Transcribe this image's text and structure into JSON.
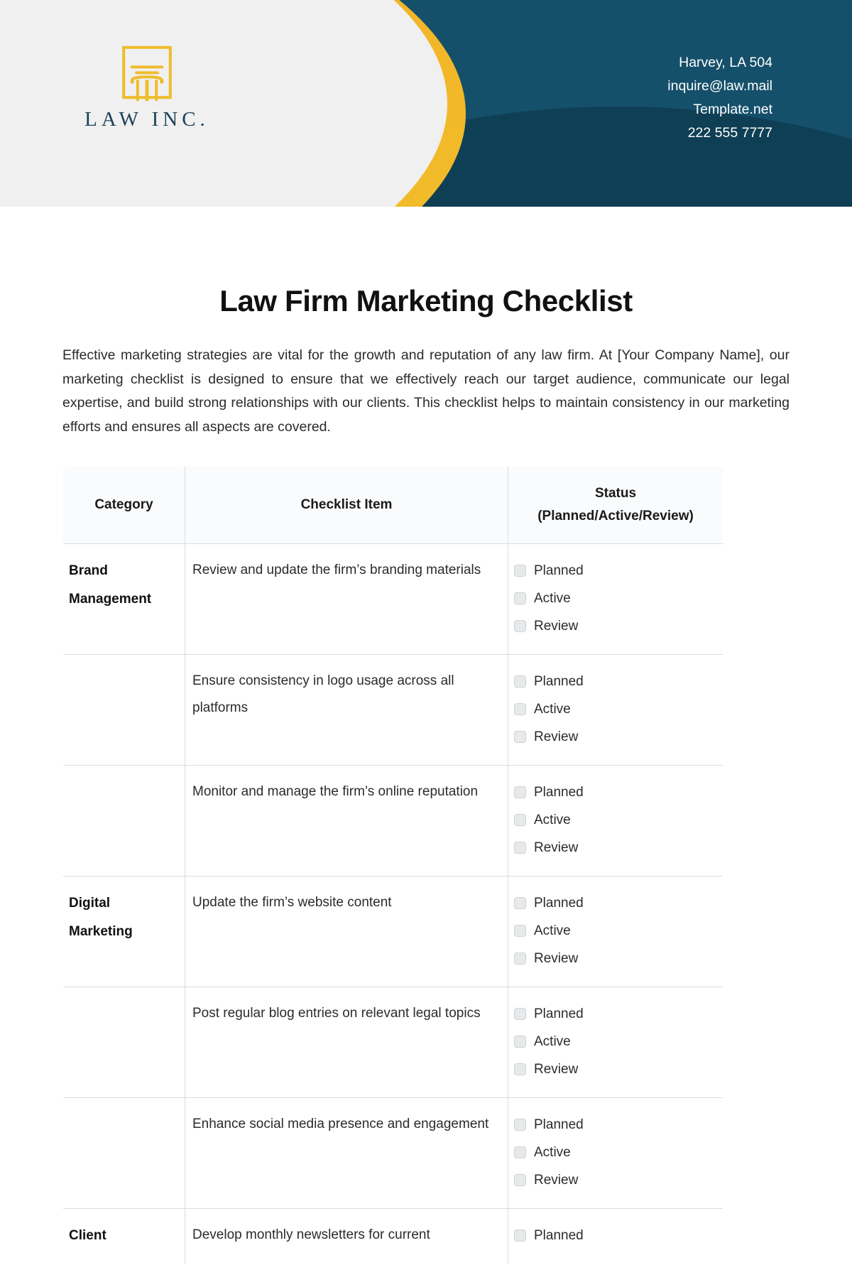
{
  "brand": {
    "logo_icon": "law-pillar-icon",
    "name": "LAW INC."
  },
  "header": {
    "contact_lines": [
      "Harvey, LA 504",
      "inquire@law.mail",
      "Template.net",
      "222 555 7777"
    ],
    "colors": {
      "dark_teal": "#11445c",
      "orange": "#f0a41f",
      "yellow": "#efc12b",
      "light_gray": "#f0f0f0",
      "logo_gold": "#eebc2c",
      "logo_navy": "#1d4258"
    }
  },
  "document": {
    "title": "Law Firm Marketing Checklist",
    "intro": "Effective marketing strategies are vital for the growth and reputation of any law firm. At [Your Company Name], our marketing checklist is designed to ensure that we effectively reach our target audience, communicate our legal expertise, and build strong relationships with our clients. This checklist helps to maintain consistency in our marketing efforts and ensures all aspects are covered."
  },
  "table": {
    "headers": [
      "Category",
      "Checklist Item",
      "Status (Planned/Active/Review)"
    ],
    "status_options": [
      "Planned",
      "Active",
      "Review"
    ],
    "rows": [
      {
        "category": "Brand Management",
        "item": "Review and update the firm’s branding materials",
        "options": [
          "Planned",
          "Active",
          "Review"
        ]
      },
      {
        "category": "",
        "item": "Ensure consistency in logo usage across all platforms",
        "options": [
          "Planned",
          "Active",
          "Review"
        ]
      },
      {
        "category": "",
        "item": "Monitor and manage the firm’s online reputation",
        "options": [
          "Planned",
          "Active",
          "Review"
        ]
      },
      {
        "category": "Digital Marketing",
        "item": "Update the firm’s website content",
        "options": [
          "Planned",
          "Active",
          "Review"
        ]
      },
      {
        "category": "",
        "item": "Post regular blog entries on relevant legal topics",
        "options": [
          "Planned",
          "Active",
          "Review"
        ]
      },
      {
        "category": "",
        "item": "Enhance social media presence and engagement",
        "options": [
          "Planned",
          "Active",
          "Review"
        ]
      },
      {
        "category": "Client",
        "item": "Develop monthly newsletters for current",
        "options": [
          "Planned"
        ]
      }
    ]
  }
}
